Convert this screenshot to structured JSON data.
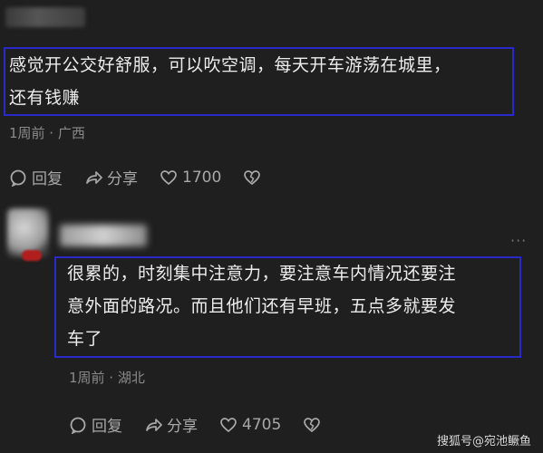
{
  "comments": [
    {
      "text": "感觉开公交好舒服，可以吹空调，每天开车游荡在城里，\n还有钱赚",
      "time_location": "1周前 · 广西",
      "reply_label": "回复",
      "share_label": "分享",
      "like_count": "1700"
    },
    {
      "text": "很累的，时刻集中注意力，要注意车内情况还要注\n意外面的路况。而且他们还有早班，五点多就要发\n车了",
      "time_location": "1周前 · 湖北",
      "reply_label": "回复",
      "share_label": "分享",
      "like_count": "4705"
    }
  ],
  "more_label": "···",
  "watermark": "搜狐号@宛池鳜鱼",
  "colors": {
    "background": "#1f1f1f",
    "highlight_border": "#2a2ac8",
    "text": "#ededed",
    "meta": "#8a8a8a"
  }
}
